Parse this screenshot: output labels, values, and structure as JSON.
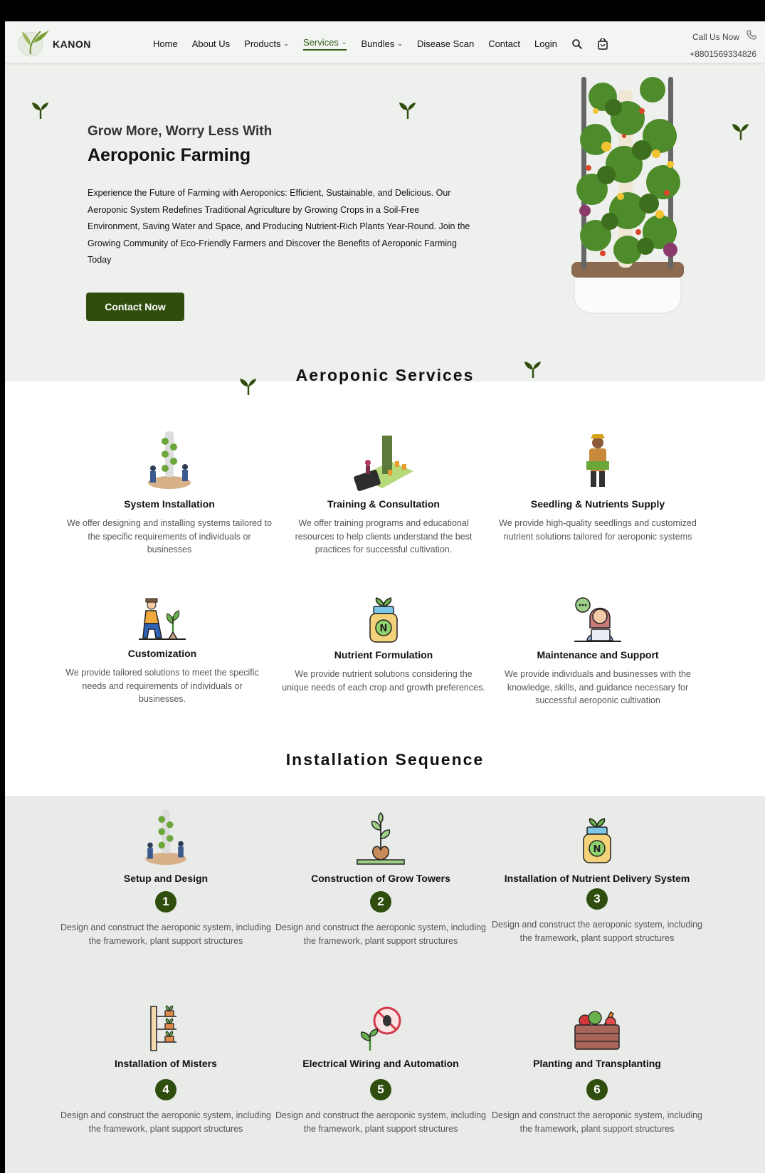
{
  "header": {
    "brand": "KANON",
    "nav": [
      {
        "label": "Home",
        "dropdown": false,
        "active": false
      },
      {
        "label": "About Us",
        "dropdown": false,
        "active": false
      },
      {
        "label": "Products",
        "dropdown": true,
        "active": false
      },
      {
        "label": "Services",
        "dropdown": true,
        "active": true
      },
      {
        "label": "Bundles",
        "dropdown": true,
        "active": false
      },
      {
        "label": "Disease Scan",
        "dropdown": false,
        "active": false
      },
      {
        "label": "Contact",
        "dropdown": false,
        "active": false
      },
      {
        "label": "Login",
        "dropdown": false,
        "active": false
      }
    ],
    "call_label": "Call Us Now",
    "phone": "+8801569334826",
    "icons": [
      "search-icon",
      "shopping-bag-icon",
      "phone-icon"
    ]
  },
  "hero": {
    "subtitle": "Grow More, Worry Less With",
    "title": "Aeroponic Farming",
    "description": "Experience the Future of Farming with Aeroponics: Efficient, Sustainable, and Delicious. Our Aeroponic System Redefines Traditional Agriculture by Growing Crops in a Soil-Free Environment, Saving Water and Space, and Producing Nutrient-Rich Plants Year-Round. Join the Growing Community of Eco-Friendly Farmers and Discover the Benefits of Aeroponic Farming Today",
    "cta": "Contact Now"
  },
  "services": {
    "title": "Aeroponic Services",
    "items": [
      {
        "title": "System Installation",
        "desc": "We offer designing and installing  systems tailored to the specific requirements of individuals or businesses",
        "icon": "tower-installation-icon"
      },
      {
        "title": "Training & Consultation",
        "desc": "We offer training programs and educational resources to help clients understand the best practices for successful cultivation.",
        "icon": "training-phone-icon"
      },
      {
        "title": "Seedling & Nutrients Supply",
        "desc": "We provide high-quality seedlings and customized nutrient solutions tailored for aeroponic systems",
        "icon": "farmer-icon"
      },
      {
        "title": "Customization",
        "desc": "We provide tailored solutions to meet the specific needs and requirements of individuals or businesses.",
        "icon": "gardener-icon"
      },
      {
        "title": "Nutrient Formulation",
        "desc": "We provide nutrient solutions considering the unique needs of each crop and growth preferences.",
        "icon": "nutrient-bottle-icon"
      },
      {
        "title": "Maintenance and Support",
        "desc": "We provide individuals and businesses with the knowledge, skills, and guidance necessary for successful aeroponic cultivation",
        "icon": "support-agent-icon"
      }
    ]
  },
  "sequence": {
    "title": "Installation Sequence",
    "steps": [
      {
        "title": "Setup and Design",
        "num": "1",
        "desc": "Design and construct the aeroponic system, including the framework, plant support structures",
        "icon": "tower-installation-icon"
      },
      {
        "title": "Construction of Grow Towers",
        "num": "2",
        "desc": "Design and construct the aeroponic system, including the framework, plant support structures",
        "icon": "seedling-icon"
      },
      {
        "title": "Installation of Nutrient Delivery System",
        "num": "3",
        "desc": "Design and construct the aeroponic system, including the framework, plant support structures",
        "icon": "nutrient-bottle-icon"
      },
      {
        "title": "Installation of Misters",
        "num": "4",
        "desc": "Design and construct the aeroponic system, including the framework, plant support structures",
        "icon": "vertical-rack-icon"
      },
      {
        "title": "Electrical Wiring and Automation",
        "num": "5",
        "desc": "Design and construct the aeroponic system, including the framework, plant support structures",
        "icon": "pest-control-icon"
      },
      {
        "title": "Planting and Transplanting",
        "num": "6",
        "desc": "Design and construct the aeroponic system, including the framework, plant support structures",
        "icon": "vegetable-crate-icon"
      }
    ]
  },
  "colors": {
    "primary": "#2f4e0e",
    "hero_bg": "#eef0ed",
    "sequence_bg": "#e9ebe8"
  }
}
